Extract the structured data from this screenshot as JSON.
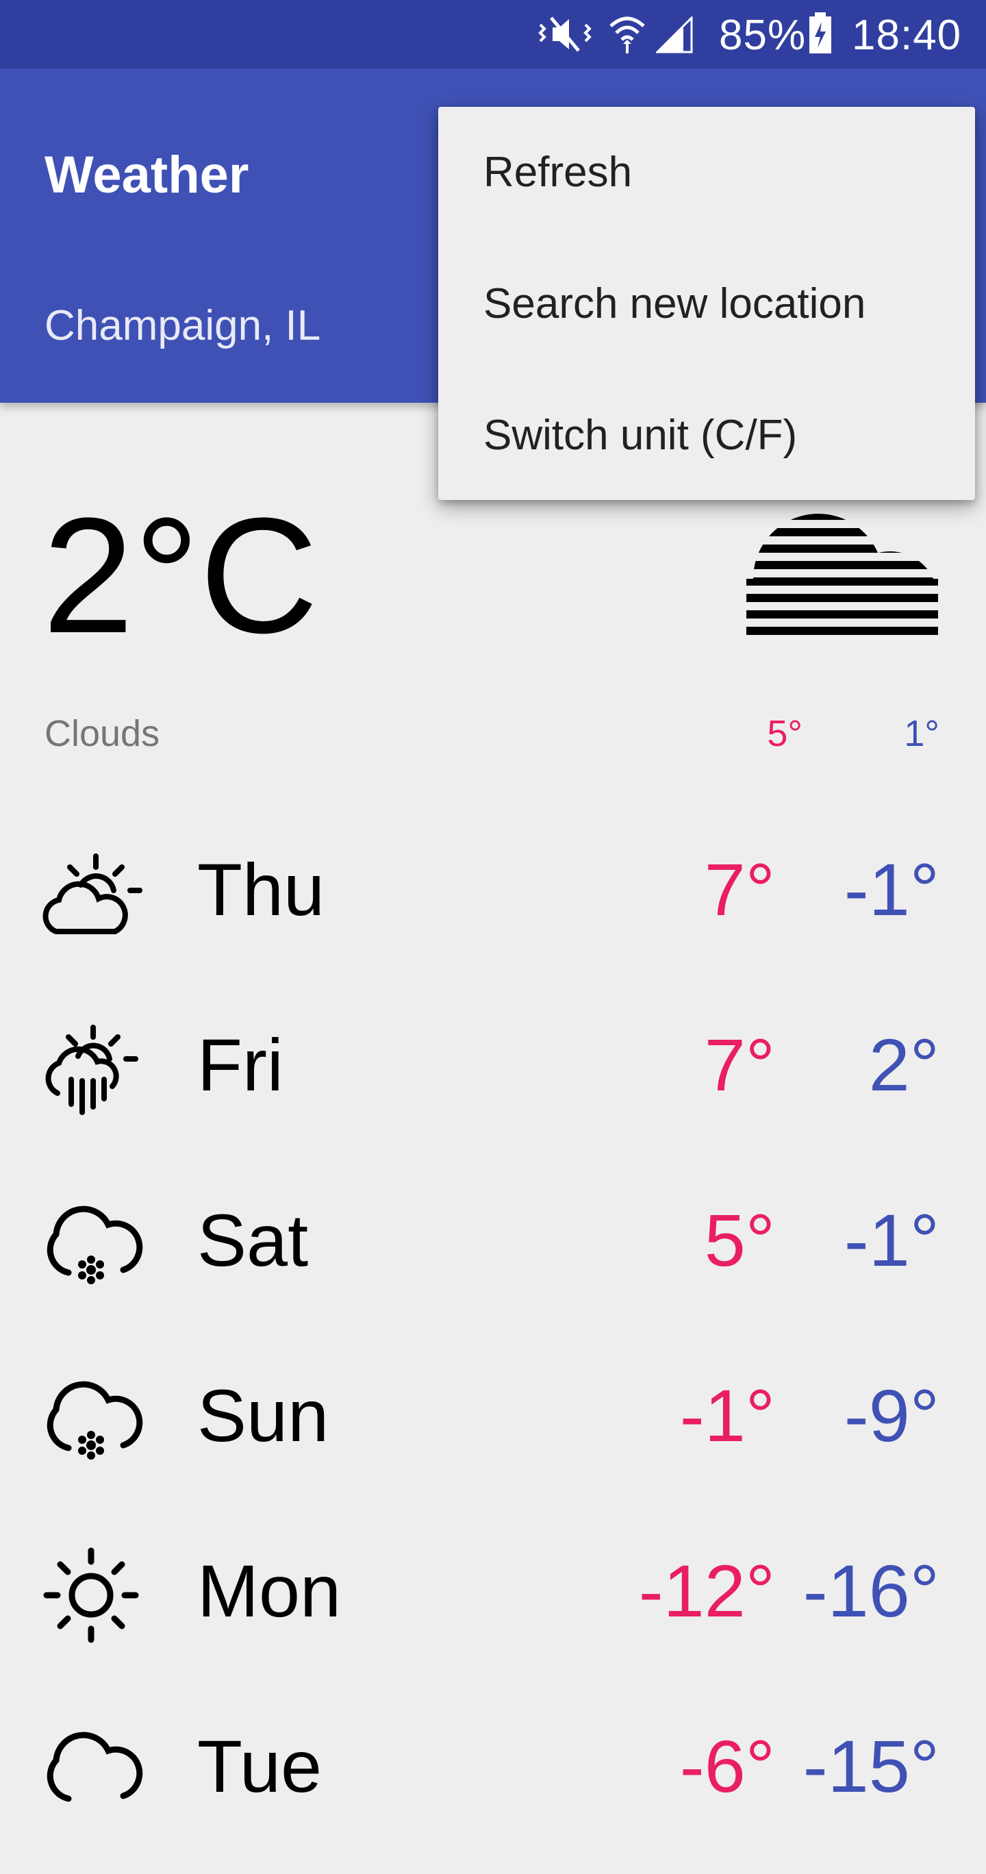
{
  "status_bar": {
    "battery": "85%",
    "time": "18:40",
    "icons": [
      "mute-icon",
      "wifi-icon",
      "signal-icon",
      "battery-charging-icon"
    ]
  },
  "app_bar": {
    "title": "Weather",
    "location": "Champaign, IL"
  },
  "current": {
    "temperature": "2°C",
    "description": "Clouds",
    "high": "5°",
    "low": "1°",
    "icon": "fog-clouds-icon"
  },
  "forecast": [
    {
      "day": "Thu",
      "high": "7°",
      "low": "-1°",
      "icon": "partly-cloudy-icon"
    },
    {
      "day": "Fri",
      "high": "7°",
      "low": "2°",
      "icon": "rain-sun-icon"
    },
    {
      "day": "Sat",
      "high": "5°",
      "low": "-1°",
      "icon": "snow-icon"
    },
    {
      "day": "Sun",
      "high": "-1°",
      "low": "-9°",
      "icon": "snow-icon"
    },
    {
      "day": "Mon",
      "high": "-12°",
      "low": "-16°",
      "icon": "sun-icon"
    },
    {
      "day": "Tue",
      "high": "-6°",
      "low": "-15°",
      "icon": "cloud-icon"
    }
  ],
  "menu": {
    "items": [
      "Refresh",
      "Search new location",
      "Switch unit (C/F)"
    ]
  },
  "colors": {
    "primary": "#3f51b5",
    "primary_dark": "#303f9f",
    "high_temp": "#e91e63",
    "low_temp": "#3f51b5"
  }
}
